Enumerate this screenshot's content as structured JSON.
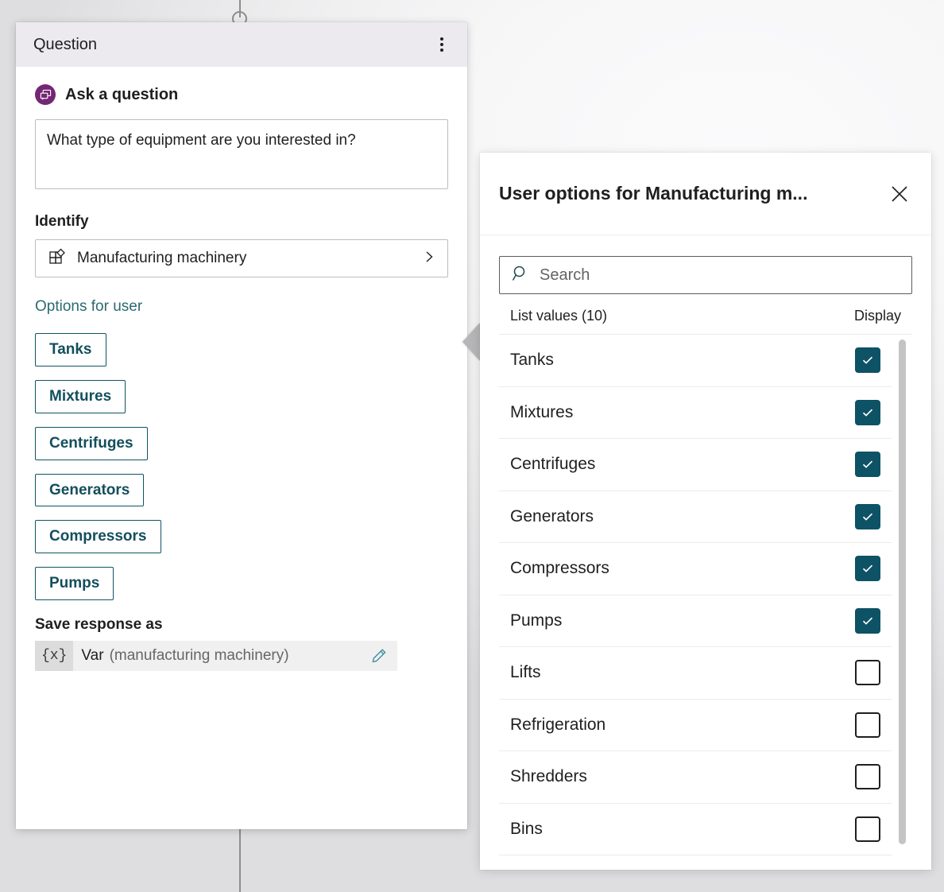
{
  "theme": {
    "accent_teal": "#0d5265",
    "chip_text": "#134f5c",
    "link_teal": "#2a6b72",
    "badge_purple": "#742774",
    "header_bg": "#ece9ef"
  },
  "card": {
    "title": "Question",
    "menu_icon": "kebab-menu-icon",
    "ask": {
      "icon": "question-bubble-icon",
      "label": "Ask a question",
      "question_text": "What type of equipment are you interested in?"
    },
    "identify": {
      "label": "Identify",
      "icon": "entity-grid-icon",
      "value": "Manufacturing machinery",
      "chevron": "chevron-right-icon"
    },
    "options_link": "Options for user",
    "option_chips": [
      "Tanks",
      "Mixtures",
      "Centrifuges",
      "Generators",
      "Compressors",
      "Pumps"
    ],
    "save_response": {
      "label": "Save response as",
      "braces": "{x}",
      "var_name": "Var",
      "var_scope": "(manufacturing machinery)",
      "edit_icon": "pencil-icon"
    }
  },
  "panel": {
    "title": "User options for Manufacturing m...",
    "close_icon": "close-icon",
    "search": {
      "icon": "search-icon",
      "placeholder": "Search",
      "value": ""
    },
    "columns": {
      "values_header": "List values (10)",
      "display_header": "Display"
    },
    "rows": [
      {
        "label": "Tanks",
        "checked": true
      },
      {
        "label": "Mixtures",
        "checked": true
      },
      {
        "label": "Centrifuges",
        "checked": true
      },
      {
        "label": "Generators",
        "checked": true
      },
      {
        "label": "Compressors",
        "checked": true
      },
      {
        "label": "Pumps",
        "checked": true
      },
      {
        "label": "Lifts",
        "checked": false
      },
      {
        "label": "Refrigeration",
        "checked": false
      },
      {
        "label": "Shredders",
        "checked": false
      },
      {
        "label": "Bins",
        "checked": false
      }
    ]
  }
}
